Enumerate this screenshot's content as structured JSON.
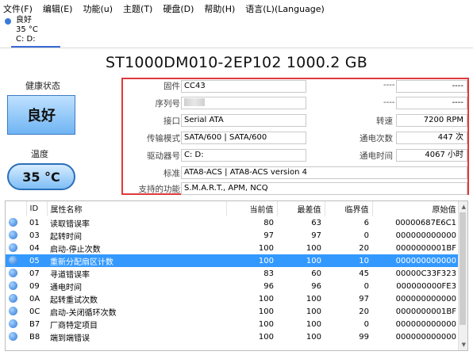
{
  "menu": [
    "文件(F)",
    "编辑(E)",
    "功能(u)",
    "主题(T)",
    "硬盘(D)",
    "帮助(H)",
    "语言(L)(Language)"
  ],
  "drive_tab": {
    "status": "良好",
    "temp": "35 °C",
    "letters": "C: D:"
  },
  "title": "ST1000DM010-2EP102 1000.2 GB",
  "health": {
    "label": "健康状态",
    "value": "良好"
  },
  "temperature": {
    "label": "温度",
    "value": "35 °C"
  },
  "info": {
    "firmware": {
      "label": "固件",
      "value": "CC43"
    },
    "serial": {
      "label": "序列号",
      "value": ""
    },
    "interface": {
      "label": "接口",
      "value": "Serial ATA"
    },
    "transfer": {
      "label": "传输模式",
      "value": "SATA/600 | SATA/600"
    },
    "drive_letter": {
      "label": "驱动器号",
      "value": "C: D:"
    },
    "standard": {
      "label": "标准",
      "value": "ATA8-ACS | ATA8-ACS version 4"
    },
    "features": {
      "label": "支持的功能",
      "value": "S.M.A.R.T., APM, NCQ"
    },
    "rotation": {
      "label": "转速",
      "value": "7200 RPM"
    },
    "power_count": {
      "label": "通电次数",
      "value": "447 次"
    },
    "power_hours": {
      "label": "通电时间",
      "value": "4067 小时"
    },
    "dash1": "----",
    "dash2": "----",
    "dash3": "----",
    "dash4": "----"
  },
  "table": {
    "headers": [
      "ID",
      "属性名称",
      "当前值",
      "最差值",
      "临界值",
      "原始值"
    ],
    "rows": [
      {
        "id": "01",
        "name": "读取错误率",
        "cur": "80",
        "worst": "63",
        "thr": "6",
        "raw": "00000687E6C1"
      },
      {
        "id": "03",
        "name": "起转时间",
        "cur": "97",
        "worst": "97",
        "thr": "0",
        "raw": "000000000000"
      },
      {
        "id": "04",
        "name": "启动-停止次数",
        "cur": "100",
        "worst": "100",
        "thr": "20",
        "raw": "0000000001BF"
      },
      {
        "id": "05",
        "name": "重新分配扇区计数",
        "cur": "100",
        "worst": "100",
        "thr": "10",
        "raw": "000000000000"
      },
      {
        "id": "07",
        "name": "寻道错误率",
        "cur": "83",
        "worst": "60",
        "thr": "45",
        "raw": "00000C33F323"
      },
      {
        "id": "09",
        "name": "通电时间",
        "cur": "96",
        "worst": "96",
        "thr": "0",
        "raw": "000000000FE3"
      },
      {
        "id": "0A",
        "name": "起转重试次数",
        "cur": "100",
        "worst": "100",
        "thr": "97",
        "raw": "000000000000"
      },
      {
        "id": "0C",
        "name": "启动-关闭循环次数",
        "cur": "100",
        "worst": "100",
        "thr": "20",
        "raw": "0000000001BF"
      },
      {
        "id": "B7",
        "name": "厂商特定项目",
        "cur": "100",
        "worst": "100",
        "thr": "0",
        "raw": "000000000000"
      },
      {
        "id": "B8",
        "name": "端到端错误",
        "cur": "100",
        "worst": "100",
        "thr": "99",
        "raw": "000000000000"
      }
    ],
    "selected_index": 3
  },
  "colors": {
    "highlight": "#3399ff",
    "info_border": "#e0393a",
    "status_blue": "#6fb4f3"
  }
}
